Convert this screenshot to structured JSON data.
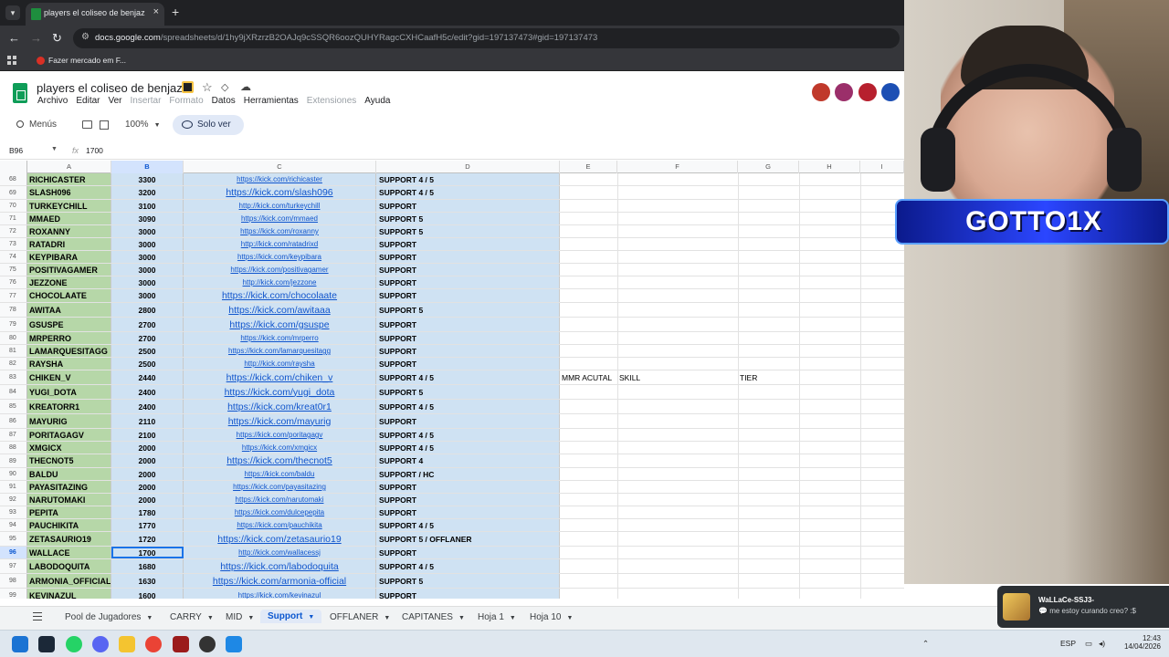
{
  "browser": {
    "tab_title": "players el coliseo de benjaz - H",
    "url_host": "docs.google.com",
    "url_path": "/spreadsheets/d/1hy9jXRzrzB2OAJq9cSSQR6oozQUHYRagcCXHCaafH5c/edit?gid=197137473#gid=197137473",
    "bookmark": "Fazer mercado em F..."
  },
  "sheets": {
    "title": "players el coliseo de benjaz",
    "menu": [
      "Archivo",
      "Editar",
      "Ver",
      "Insertar",
      "Formato",
      "Datos",
      "Herramientas",
      "Extensiones",
      "Ayuda"
    ],
    "search_label": "Menús",
    "zoom": "100%",
    "view_mode": "Solo ver",
    "name_box": "B96",
    "formula_value": "1700",
    "columns": [
      "A",
      "B",
      "C",
      "D",
      "E",
      "F",
      "G",
      "H",
      "I"
    ]
  },
  "rows": [
    {
      "n": "68",
      "name": "RICHICASTER",
      "mmr": "3300",
      "link": "https://kick.com/richicaster",
      "role": "SUPPORT 4 / 5"
    },
    {
      "n": "69",
      "name": "SLASH096",
      "mmr": "3200",
      "link": "https://kick.com/slash096",
      "role": "SUPPORT 4 / 5"
    },
    {
      "n": "70",
      "name": "TURKEYCHILL",
      "mmr": "3100",
      "link": "http://kick.com/turkeychill",
      "role": "SUPPORT"
    },
    {
      "n": "71",
      "name": "MMAED",
      "mmr": "3090",
      "link": "https://kick.com/mmaed",
      "role": "SUPPORT 5"
    },
    {
      "n": "72",
      "name": "ROXANNY",
      "mmr": "3000",
      "link": "https://kick.com/roxanny",
      "role": "SUPPORT 5"
    },
    {
      "n": "73",
      "name": "RATADRI",
      "mmr": "3000",
      "link": "http://kick.com/ratadrixd",
      "role": "SUPPORT"
    },
    {
      "n": "74",
      "name": "KEYPIBARA",
      "mmr": "3000",
      "link": "https://kick.com/keypibara",
      "role": "SUPPORT"
    },
    {
      "n": "75",
      "name": "POSITIVAGAMER",
      "mmr": "3000",
      "link": "https://kick.com/positivagamer",
      "role": "SUPPORT"
    },
    {
      "n": "76",
      "name": "JEZZONE",
      "mmr": "3000",
      "link": "http://kick.com/jezzone",
      "role": "SUPPORT"
    },
    {
      "n": "77",
      "name": "CHOCOLAATE",
      "mmr": "3000",
      "link": "https://kick.com/chocolaate",
      "role": "SUPPORT"
    },
    {
      "n": "78",
      "name": "AWITAA",
      "mmr": "2800",
      "link": "https://kick.com/awitaaa",
      "role": "SUPPORT 5"
    },
    {
      "n": "79",
      "name": "GSUSPE",
      "mmr": "2700",
      "link": "https://kick.com/gsuspe",
      "role": "SUPPORT"
    },
    {
      "n": "80",
      "name": "MRPERRO",
      "mmr": "2700",
      "link": "https://kick.com/mrperro",
      "role": "SUPPORT"
    },
    {
      "n": "81",
      "name": "LAMARQUESITAGG",
      "mmr": "2500",
      "link": "https://kick.com/lamarquesitagg",
      "role": "SUPPORT"
    },
    {
      "n": "82",
      "name": "RAYSHA",
      "mmr": "2500",
      "link": "http://kick.com/raysha",
      "role": "SUPPORT"
    },
    {
      "n": "83",
      "name": "CHIKEN_V",
      "mmr": "2440",
      "link": "https://kick.com/chiken_v",
      "role": "SUPPORT 4 / 5"
    },
    {
      "n": "84",
      "name": "YUGI_DOTA",
      "mmr": "2400",
      "link": "https://kick.com/yugi_dota",
      "role": "SUPPORT 5"
    },
    {
      "n": "85",
      "name": "KREATORR1",
      "mmr": "2400",
      "link": "https://kick.com/kreat0r1",
      "role": "SUPPORT 4 / 5"
    },
    {
      "n": "86",
      "name": "MAYURIG",
      "mmr": "2110",
      "link": "https://kick.com/mayurig",
      "role": "SUPPORT"
    },
    {
      "n": "87",
      "name": "PORITAGAGV",
      "mmr": "2100",
      "link": "https://kick.com/poritagagv",
      "role": "SUPPORT 4 / 5"
    },
    {
      "n": "88",
      "name": "XMGICX",
      "mmr": "2000",
      "link": "https://kick.com/xmgicx",
      "role": "SUPPORT 4 / 5"
    },
    {
      "n": "89",
      "name": "THECNOT5",
      "mmr": "2000",
      "link": "https://kick.com/thecnot5",
      "role": "SUPPORT 4"
    },
    {
      "n": "90",
      "name": "BALDU",
      "mmr": "2000",
      "link": "https://kick.com/baldu",
      "role": "SUPPORT / HC"
    },
    {
      "n": "91",
      "name": "PAYASITAZING",
      "mmr": "2000",
      "link": "https://kick.com/payasitazing",
      "role": "SUPPORT"
    },
    {
      "n": "92",
      "name": "NARUTOMAKI",
      "mmr": "2000",
      "link": "https://kick.com/narutomaki",
      "role": "SUPPORT"
    },
    {
      "n": "93",
      "name": "PEPITA",
      "mmr": "1780",
      "link": "https://kick.com/dulcepepita",
      "role": "SUPPORT"
    },
    {
      "n": "94",
      "name": "PAUCHIKITA",
      "mmr": "1770",
      "link": "https://kick.com/pauchikita",
      "role": "SUPPORT 4 / 5"
    },
    {
      "n": "95",
      "name": "ZETASAURIO19",
      "mmr": "1720",
      "link": "https://kick.com/zetasaurio19",
      "role": "SUPPORT 5 / OFFLANER"
    },
    {
      "n": "96",
      "name": "WALLACE",
      "mmr": "1700",
      "link": "http://kick.com/wallacessj",
      "role": "SUPPORT"
    },
    {
      "n": "97",
      "name": "LABODOQUITA",
      "mmr": "1680",
      "link": "https://kick.com/labodoquita",
      "role": "SUPPORT 4 / 5"
    },
    {
      "n": "98",
      "name": "ARMONIA_OFFICIAL",
      "mmr": "1630",
      "link": "https://kick.com/armonia-official",
      "role": "SUPPORT 5"
    },
    {
      "n": "99",
      "name": "KEVINAZUL",
      "mmr": "1600",
      "link": "https://kick.com/kevinazul",
      "role": "SUPPORT"
    }
  ],
  "side_headers": {
    "e": "MMR ACUTAL",
    "f": "SKILL",
    "g": "TIER"
  },
  "sheet_tabs": [
    "Pool de Jugadores",
    "CARRY",
    "MID",
    "Support",
    "OFFLANER",
    "CAPITANES",
    "Hoja 1",
    "Hoja 10"
  ],
  "active_tab": "Support",
  "overlay": {
    "banner": "GOTTO1X"
  },
  "notification": {
    "name": "WaLLaCe-SSJ3-",
    "message": "me estoy curando creo? :$"
  },
  "taskbar": {
    "lang": "ESP",
    "time": "12:43",
    "date": "14/04/2026"
  },
  "colors": {
    "green": "#b6d7a8",
    "blue": "#cfe2f3",
    "link": "#1155cc",
    "select": "#1a73e8"
  }
}
